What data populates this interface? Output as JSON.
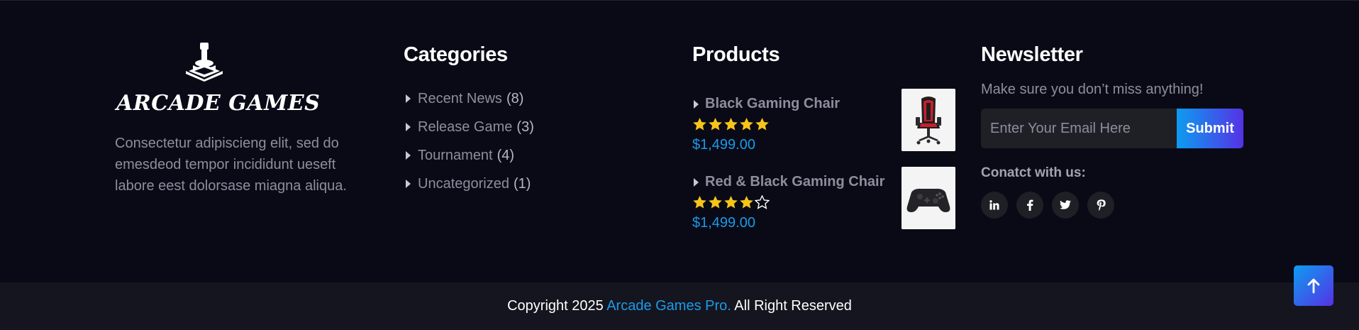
{
  "about": {
    "logo_text": "ARCADE GAMES",
    "description": "Consectetur adipiscieng elit, sed do emesdeod tempor incididunt ueseft labore eest dolorsase miagna aliqua."
  },
  "categories": {
    "title": "Categories",
    "items": [
      {
        "label": "Recent News",
        "count": "(8)"
      },
      {
        "label": "Release Game",
        "count": "(3)"
      },
      {
        "label": "Tournament",
        "count": "(4)"
      },
      {
        "label": "Uncategorized",
        "count": "(1)"
      }
    ]
  },
  "products": {
    "title": "Products",
    "items": [
      {
        "name": "Black Gaming Chair",
        "rating": 5,
        "rating_max": 5,
        "price": "$1,499.00",
        "image_icon": "gaming-chair-image"
      },
      {
        "name": "Red & Black Gaming Chair",
        "rating": 4,
        "rating_max": 5,
        "price": "$1,499.00",
        "image_icon": "game-controller-image"
      }
    ]
  },
  "newsletter": {
    "title": "Newsletter",
    "text": "Make sure you don’t miss anything!",
    "email_placeholder": "Enter Your Email Here",
    "submit_label": "Submit",
    "connect_title": "Conatct with us:",
    "socials": [
      {
        "label": "in",
        "icon": "linkedin-icon"
      },
      {
        "label": "f",
        "icon": "facebook-icon"
      },
      {
        "label": "twitter",
        "icon": "twitter-icon"
      },
      {
        "label": "pinterest",
        "icon": "pinterest-icon"
      }
    ]
  },
  "footer": {
    "copyright_prefix": "Copyright 2025",
    "brand": "Arcade Games Pro.",
    "copyright_suffix": "All Right Reserved"
  },
  "colors": {
    "background": "#0a0a17",
    "bottom_bar": "#15151f",
    "accent_blue": "#1a9be8",
    "accent_purple": "#5532e6",
    "star": "#f5c518"
  }
}
